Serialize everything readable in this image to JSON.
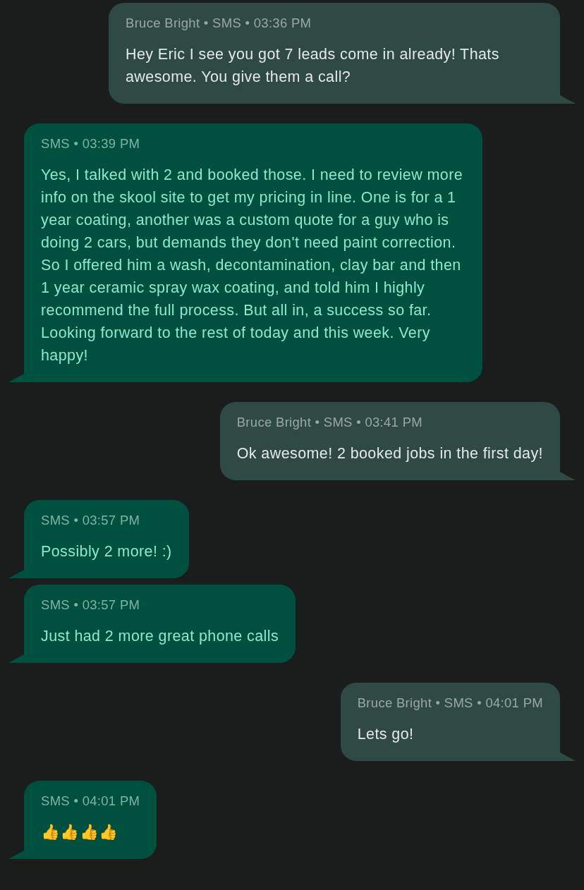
{
  "messages": [
    {
      "kind": "sent",
      "meta": "Bruce Bright • SMS • 03:36 PM",
      "text": "Hey Eric I see you got 7 leads come in already! Thats awesome. You give them a call?"
    },
    {
      "kind": "received",
      "meta": "SMS • 03:39 PM",
      "text": "Yes, I talked with 2 and booked those. I need to review more info on the skool site to get my pricing in line. One is for a 1 year coating, another was a custom quote for a guy who is doing 2 cars, but demands they don't need paint correction. So I offered him a wash, decontamination, clay bar and then 1 year ceramic spray wax coating, and told him I highly recommend the full process. But all in, a success so far. Looking forward to the rest of today and this week. Very happy!"
    },
    {
      "kind": "sent",
      "meta": "Bruce Bright • SMS • 03:41 PM",
      "text": "Ok awesome! 2 booked jobs in the first day!"
    },
    {
      "kind": "received",
      "meta": "SMS • 03:57 PM",
      "text": "Possibly 2 more! :)"
    },
    {
      "kind": "received",
      "meta": "SMS • 03:57 PM",
      "text": "Just had 2 more great phone calls"
    },
    {
      "kind": "sent",
      "meta": "Bruce Bright • SMS • 04:01 PM",
      "text": "Lets go!"
    },
    {
      "kind": "received",
      "meta": "SMS • 04:01 PM",
      "text": "👍👍👍👍"
    }
  ]
}
